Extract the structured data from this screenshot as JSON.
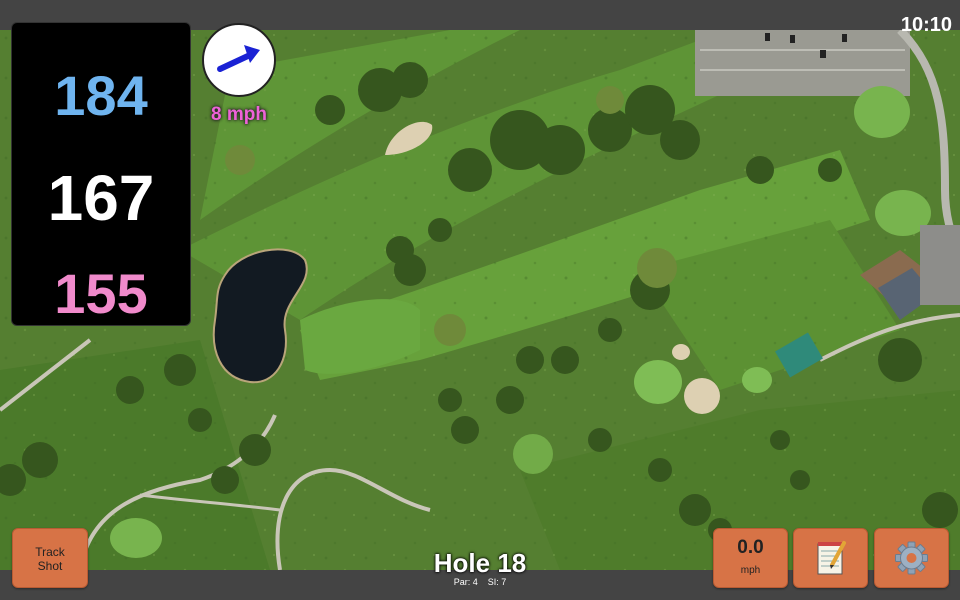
{
  "status": {
    "time": "10:10"
  },
  "distances": {
    "back": "184",
    "middle": "167",
    "front": "155"
  },
  "wind": {
    "speed_label": "8 mph",
    "direction_icon": "wind-arrow-icon"
  },
  "hole": {
    "title": "Hole 18",
    "par": "Par: 4",
    "si": "SI: 7"
  },
  "buttons": {
    "track_shot": [
      "Track",
      "Shot"
    ],
    "speed_value": "0.0",
    "speed_unit": "mph",
    "notes_icon": "notepad-icon",
    "settings_icon": "gear-icon"
  },
  "colors": {
    "back": "#6fb4ef",
    "middle": "#ffffff",
    "front": "#f08acb",
    "button": "#d77346",
    "wind_text": "#ee62d8"
  }
}
